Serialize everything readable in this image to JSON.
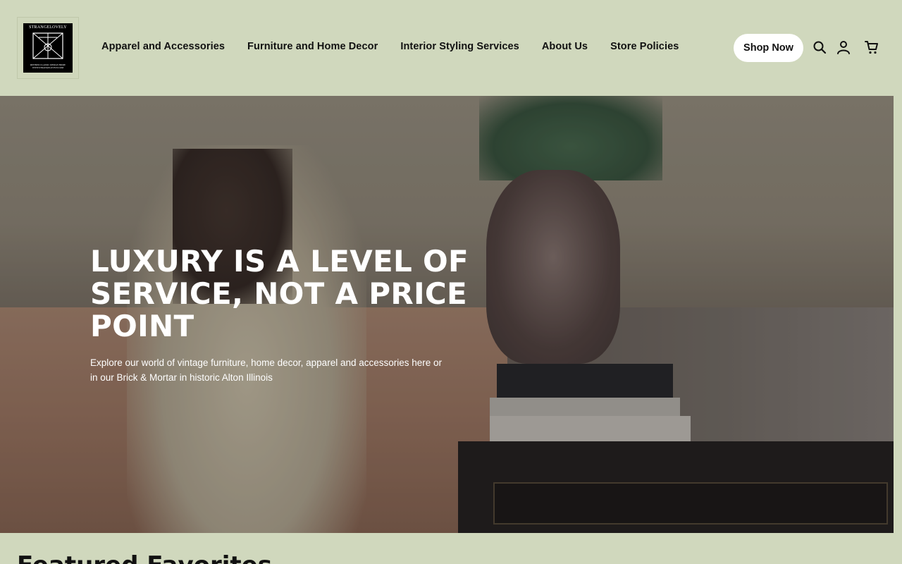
{
  "logo": {
    "brand": "STRANGELOVELY",
    "tagline": "REFINED CLASSIC DESIGN HOME",
    "url": "WWW.STRANGELOVELY.COM"
  },
  "nav": {
    "items": [
      {
        "label": "Apparel and Accessories"
      },
      {
        "label": "Furniture and Home Decor"
      },
      {
        "label": "Interior Styling Services"
      },
      {
        "label": "About Us"
      },
      {
        "label": "Store Policies"
      }
    ]
  },
  "header": {
    "cta_label": "Shop Now",
    "icons": [
      "search-icon",
      "account-icon",
      "cart-icon"
    ]
  },
  "hero": {
    "heading": "LUXURY IS A LEVEL OF SERVICE, NOT A PRICE POINT",
    "body": "Explore our world of vintage furniture, home decor, apparel and accessories here or in our Brick & Mortar in historic Alton Illinois"
  },
  "featured": {
    "title": "Featured Favorites"
  },
  "colors": {
    "background": "#d0d8bd",
    "button_bg": "#ffffff",
    "text": "#111111"
  }
}
